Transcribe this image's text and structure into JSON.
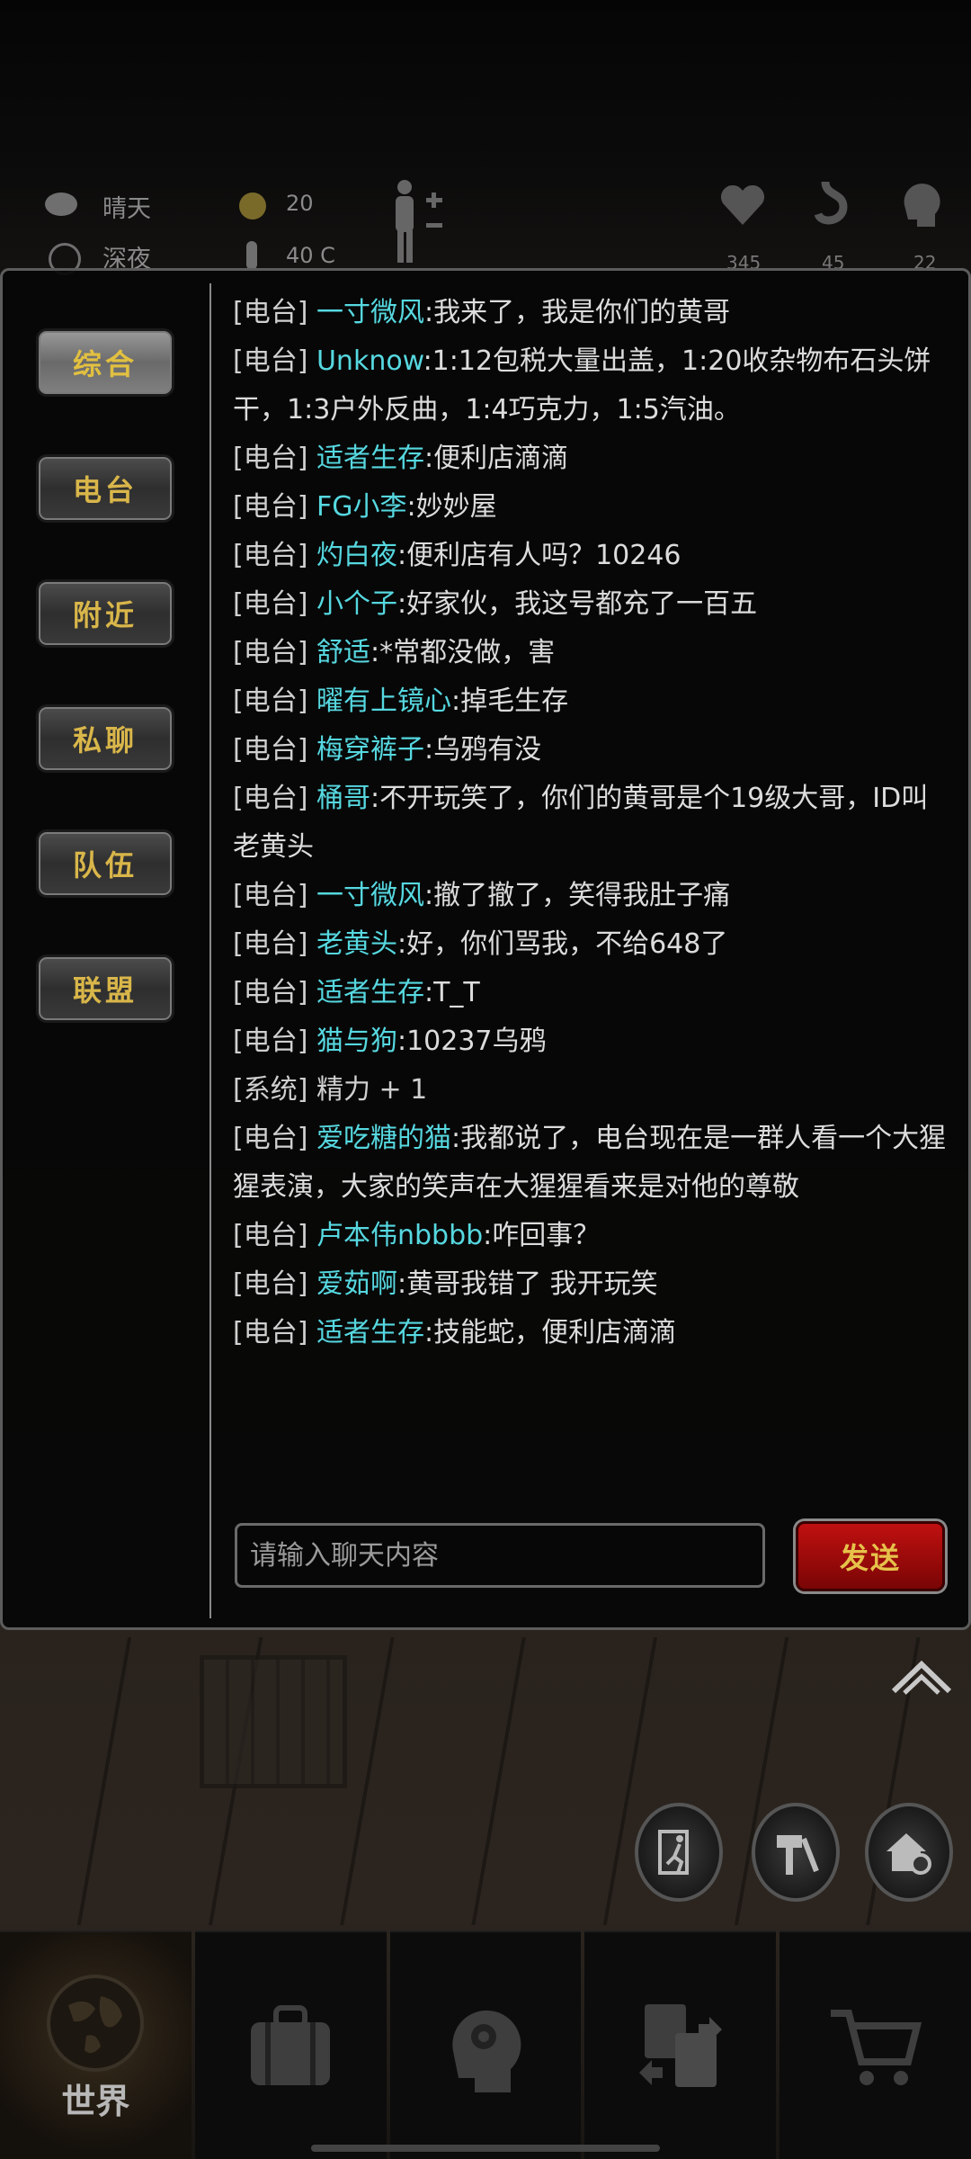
{
  "status": {
    "weather": "晴天",
    "time_of_day": "深夜",
    "radiation": "20",
    "temperature": "40 C",
    "health": "345",
    "hunger": "45",
    "mind": "22"
  },
  "channels": [
    {
      "label": "综合",
      "active": true
    },
    {
      "label": "电台",
      "active": false
    },
    {
      "label": "附近",
      "active": false
    },
    {
      "label": "私聊",
      "active": false
    },
    {
      "label": "队伍",
      "active": false
    },
    {
      "label": "联盟",
      "active": false
    }
  ],
  "messages": [
    {
      "tag": "[电台]",
      "user": "一寸微风",
      "text": ":我来了，我是你们的黄哥"
    },
    {
      "tag": "[电台]",
      "user": "Unknow",
      "text": ":1:12包税大量出盖，1:20收杂物布石头饼干，1:3户外反曲，1:4巧克力，1:5汽油。"
    },
    {
      "tag": "[电台]",
      "user": "适者生存",
      "text": ":便利店滴滴"
    },
    {
      "tag": "[电台]",
      "user": "FG小李",
      "text": ":妙妙屋"
    },
    {
      "tag": "[电台]",
      "user": "灼白夜",
      "text": ":便利店有人吗？10246"
    },
    {
      "tag": "[电台]",
      "user": "小个子",
      "text": ":好家伙，我这号都充了一百五"
    },
    {
      "tag": "[电台]",
      "user": "舒适",
      "text": ":*常都没做，害"
    },
    {
      "tag": "[电台]",
      "user": "曜有上镜心",
      "text": ":掉毛生存"
    },
    {
      "tag": "[电台]",
      "user": "梅穿裤子",
      "text": ":乌鸦有没"
    },
    {
      "tag": "[电台]",
      "user": "桶哥",
      "text": ":不开玩笑了，你们的黄哥是个19级大哥，ID叫老黄头"
    },
    {
      "tag": "[电台]",
      "user": "一寸微风",
      "text": ":撤了撤了，笑得我肚子痛"
    },
    {
      "tag": "[电台]",
      "user": "老黄头",
      "text": ":好，你们骂我，不给648了"
    },
    {
      "tag": "[电台]",
      "user": "适者生存",
      "text": ":T_T"
    },
    {
      "tag": "[电台]",
      "user": "猫与狗",
      "text": ":10237乌鸦"
    },
    {
      "tag": "[系统]",
      "user": "",
      "text": "精力 + 1",
      "system": true
    },
    {
      "tag": "[电台]",
      "user": "爱吃糖的猫",
      "text": ":我都说了，电台现在是一群人看一个大猩猩表演，大家的笑声在大猩猩看来是对他的尊敬"
    },
    {
      "tag": "[电台]",
      "user": "卢本伟nbbbb",
      "text": ":咋回事？"
    },
    {
      "tag": "[电台]",
      "user": "爱茹啊",
      "text": ":黄哥我错了 我开玩笑"
    },
    {
      "tag": "[电台]",
      "user": "适者生存",
      "text": ":技能蛇，便利店滴滴"
    }
  ],
  "input": {
    "placeholder": "请输入聊天内容",
    "value": ""
  },
  "send_label": "发送",
  "bottom_nav": [
    {
      "label": "世界",
      "icon": "globe-icon",
      "active": true
    },
    {
      "label": "",
      "icon": "backpack-icon",
      "active": false
    },
    {
      "label": "",
      "icon": "head-gear-icon",
      "active": false
    },
    {
      "label": "",
      "icon": "trade-icon",
      "active": false
    },
    {
      "label": "",
      "icon": "cart-icon",
      "active": false
    }
  ],
  "colors": {
    "username": "#56d8e0",
    "channel_text": "#d9b64a",
    "send_bg": "#a00a0a"
  }
}
